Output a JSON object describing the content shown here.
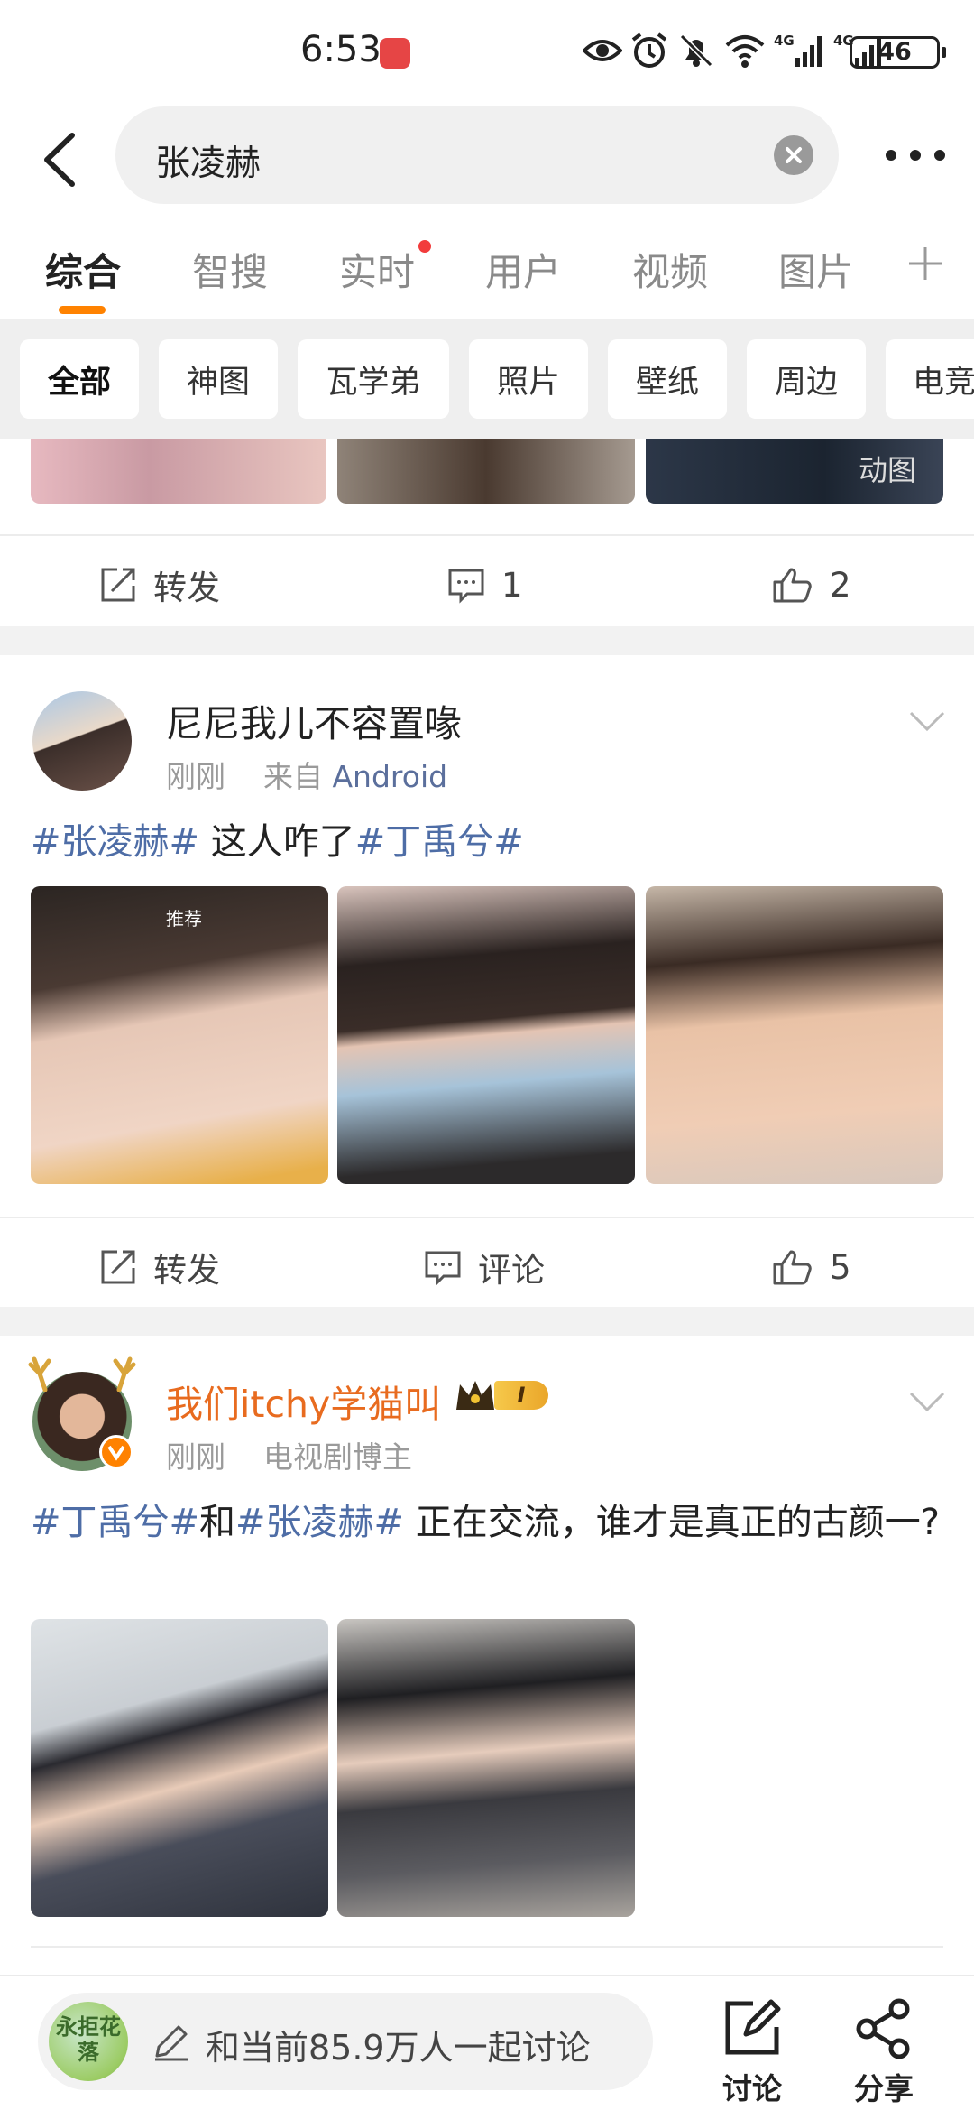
{
  "status": {
    "time": "6:53",
    "battery": "46",
    "signal_labels": [
      "4G",
      "4G"
    ]
  },
  "search": {
    "query": "张凌赫"
  },
  "tabs": [
    {
      "label": "综合",
      "active": true
    },
    {
      "label": "智搜"
    },
    {
      "label": "实时",
      "dot": true
    },
    {
      "label": "用户"
    },
    {
      "label": "视频"
    },
    {
      "label": "图片"
    }
  ],
  "chips": [
    "全部",
    "神图",
    "瓦学弟",
    "照片",
    "壁纸",
    "周边",
    "电竞"
  ],
  "post0": {
    "gif_badge": "动图",
    "repost": "转发",
    "comments": "1",
    "likes": "2"
  },
  "post1": {
    "user": "尼尼我儿不容置喙",
    "time": "刚刚",
    "source_prefix": "来自",
    "source": "Android",
    "topic1": "#张凌赫#",
    "text": " 这人咋了",
    "topic2": "#丁禹兮#",
    "img1_overlay": "推荐",
    "repost": "转发",
    "comment": "评论",
    "likes": "5"
  },
  "post2": {
    "user": "我们itchy学猫叫",
    "vip_level": "I",
    "time": "刚刚",
    "tag": "电视剧博主",
    "topic1": "#丁禹兮#",
    "mid": "和",
    "topic2": "#张凌赫#",
    "text": " 正在交流，谁才是真正的古颜一?"
  },
  "bottom": {
    "avatar_text": "永拒花落",
    "prompt": "和当前85.9万人一起讨论",
    "discuss": "讨论",
    "share": "分享"
  },
  "colors": {
    "accent": "#ff8200",
    "topic": "#4e6da6",
    "vip": "#e86b1f",
    "dot": "#f23c3c"
  }
}
